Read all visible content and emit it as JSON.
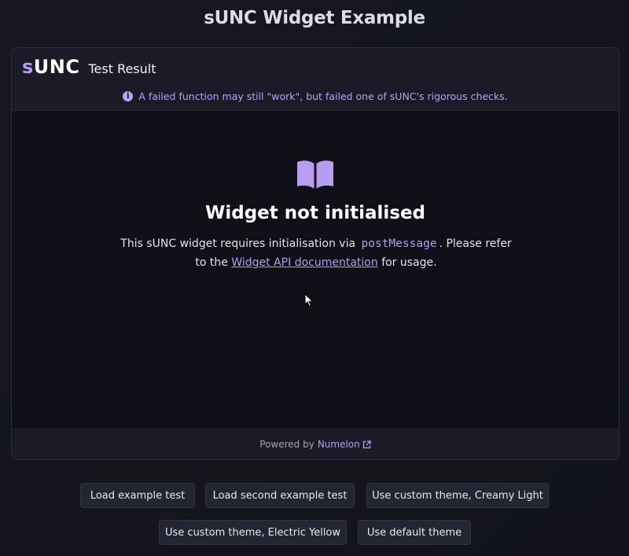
{
  "page": {
    "title": "sUNC Widget Example"
  },
  "widget": {
    "logo_s": "s",
    "logo_unc": "UNC",
    "header_title": "Test Result",
    "notice": "A failed function may still \"work\", but failed one of sUNC's rigorous checks.",
    "empty_state": {
      "title": "Widget not initialised",
      "desc_before": "This sUNC widget requires initialisation via",
      "code": "postMessage",
      "desc_middle": ". Please refer to the",
      "link": "Widget API documentation",
      "desc_after": "for usage."
    },
    "footer": {
      "prefix": "Powered by",
      "link": "Numelon"
    }
  },
  "buttons": [
    {
      "label": "Load example test"
    },
    {
      "label": "Load second example test"
    },
    {
      "label": "Use custom theme, Creamy Light"
    },
    {
      "label": "Use custom theme, Electric Yellow"
    },
    {
      "label": "Use default theme"
    }
  ],
  "colors": {
    "accent": "#b79cf0",
    "background": "#141520",
    "card": "#0f1018",
    "header": "#1b1b28"
  }
}
